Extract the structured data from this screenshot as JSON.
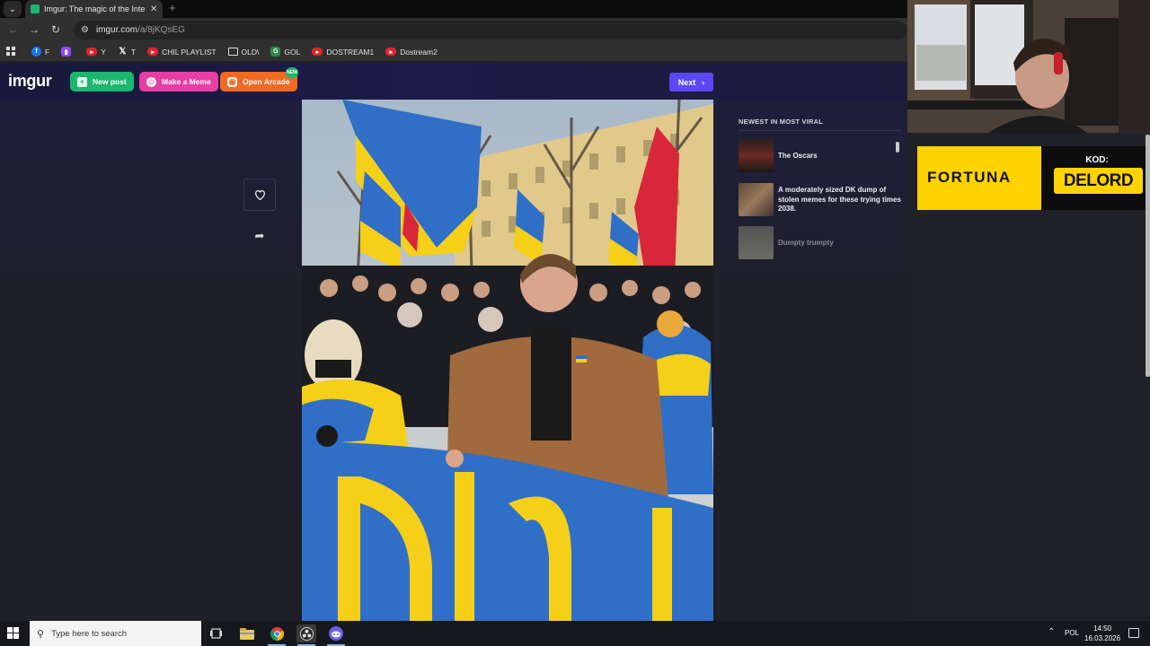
{
  "browser": {
    "tab_title": "Imgur: The magic of the Interne",
    "new_tab_glyph": "+",
    "url_domain": "imgur.com",
    "url_path": "/a/8jKQsEG",
    "bookmarks": [
      {
        "label": "F",
        "icon": "facebook-icon",
        "color": "#1877f2"
      },
      {
        "label": "",
        "icon": "twitch-icon",
        "color": "#9146ff"
      },
      {
        "label": "Y",
        "icon": "youtube-icon",
        "color": "#e0242b"
      },
      {
        "label": "T",
        "icon": "x-icon",
        "color": "#000000"
      },
      {
        "label": "CHIL PLAYLIST",
        "icon": "youtube-icon",
        "color": "#e0242b"
      },
      {
        "label": "OLD\\",
        "icon": "folder-icon",
        "color": "#303030"
      },
      {
        "label": "GOL",
        "icon": "g-icon",
        "color": "#2c8a4a"
      },
      {
        "label": "DOSTREAM1",
        "icon": "youtube-icon",
        "color": "#e0242b"
      },
      {
        "label": "Dostream2",
        "icon": "youtube-icon",
        "color": "#e0242b"
      }
    ]
  },
  "imgur": {
    "logo": "imgur",
    "new_post": "New post",
    "make_meme": "Make a Meme",
    "open_arcade": "Open Arcade",
    "arcade_badge": "NEW",
    "next": "Next",
    "sidebar_heading": "NEWEST IN MOST VIRAL",
    "viral": [
      {
        "title": "The Oscars"
      },
      {
        "title": "A moderately sized DK dump of stolen memes for these trying times 2038."
      },
      {
        "title": "Dumpty trumpty"
      }
    ],
    "colors": {
      "accent": "#5b48f5",
      "new_post": "#1bb76e",
      "meme": "#e63ea4",
      "arcade": "#f06a22"
    }
  },
  "ad": {
    "brand": "FORTUNA",
    "code_label": "KOD:",
    "code": "DELORD"
  },
  "taskbar": {
    "search_placeholder": "Type here to search",
    "lang": "POL",
    "time": "14:50",
    "date": "16.03.2026"
  }
}
